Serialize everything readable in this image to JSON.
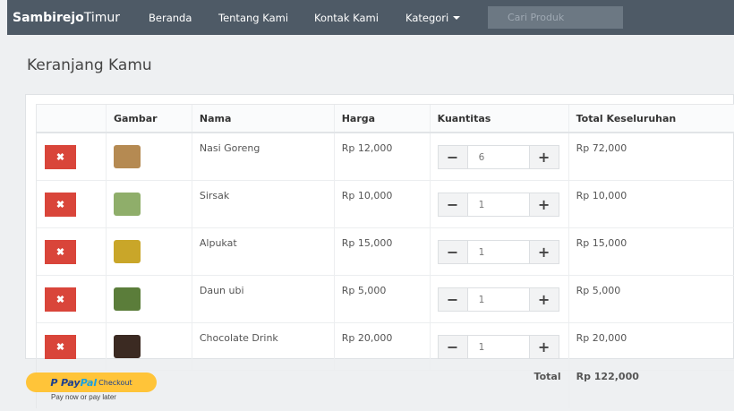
{
  "navbar": {
    "brand_bold": "Sambirejo",
    "brand_rest": "Timur",
    "links": [
      "Beranda",
      "Tentang Kami",
      "Kontak Kami"
    ],
    "kategori": "Kategori",
    "search_placeholder": "Cari Produk"
  },
  "page": {
    "title": "Keranjang Kamu"
  },
  "cart": {
    "headers": [
      "",
      "Gambar",
      "Nama",
      "Harga",
      "Kuantitas",
      "Total Keseluruhan"
    ],
    "delete_glyph": "✖",
    "minus_glyph": "−",
    "plus_glyph": "+",
    "items": [
      {
        "name": "Nasi Goreng",
        "price": "Rp 12,000",
        "qty": "6",
        "total": "Rp 72,000",
        "thumb_color": "#b58a52"
      },
      {
        "name": "Sirsak",
        "price": "Rp 10,000",
        "qty": "1",
        "total": "Rp 10,000",
        "thumb_color": "#8fae6a"
      },
      {
        "name": "Alpukat",
        "price": "Rp 15,000",
        "qty": "1",
        "total": "Rp 15,000",
        "thumb_color": "#c9a629"
      },
      {
        "name": "Daun ubi",
        "price": "Rp 5,000",
        "qty": "1",
        "total": "Rp 5,000",
        "thumb_color": "#5b7d3a"
      },
      {
        "name": "Chocolate Drink",
        "price": "Rp 20,000",
        "qty": "1",
        "total": "Rp 20,000",
        "thumb_color": "#3b2a22"
      }
    ],
    "total_label": "Total",
    "total_value": "Rp 122,000"
  },
  "paypal": {
    "logo_p": "P",
    "logo_pay": "Pay",
    "logo_pal": "Pal",
    "checkout": "Checkout",
    "subtext": "Pay now or pay later"
  },
  "colors": {
    "navbar": "#4e5a66",
    "delete_button": "#d9453a",
    "paypal_button": "#ffc439"
  }
}
